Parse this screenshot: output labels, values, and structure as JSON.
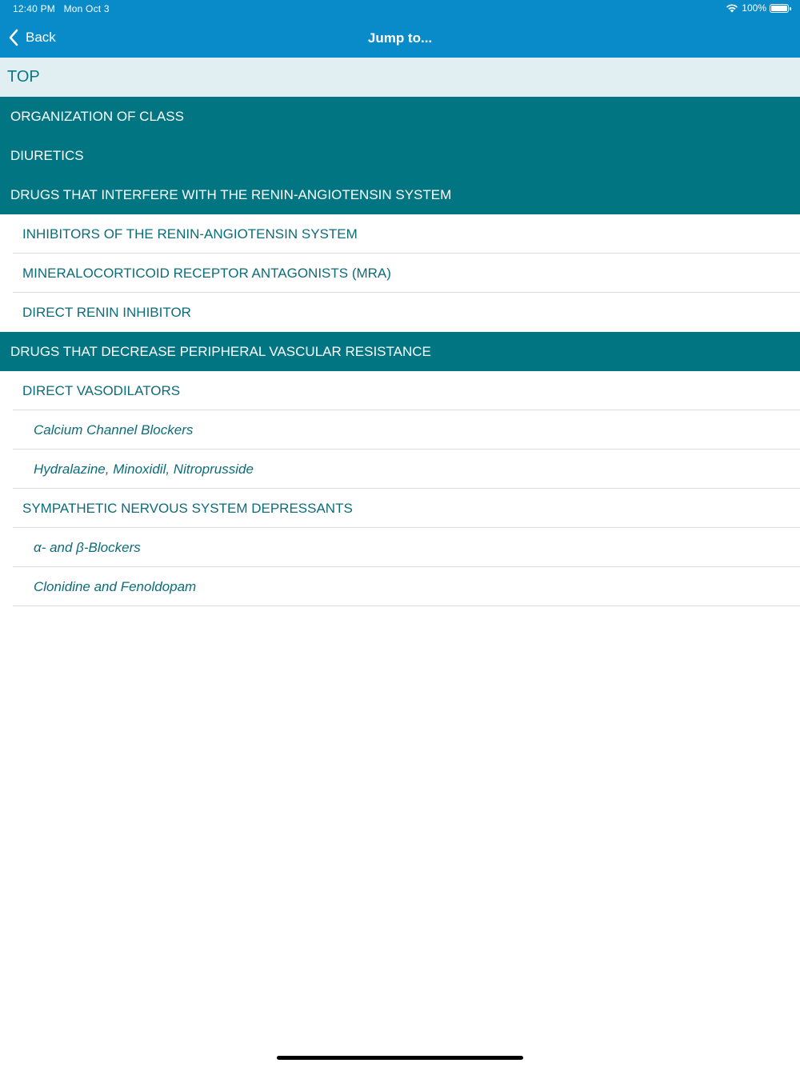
{
  "status_bar": {
    "time": "12:40 PM",
    "date": "Mon Oct 3",
    "battery": "100%"
  },
  "nav": {
    "back_label": "Back",
    "title": "Jump to..."
  },
  "toc": {
    "top": "TOP",
    "items": [
      {
        "label": "ORGANIZATION OF CLASS",
        "level": 1
      },
      {
        "label": "DIURETICS",
        "level": 1
      },
      {
        "label": "DRUGS THAT INTERFERE WITH THE RENIN-ANGIOTENSIN SYSTEM",
        "level": 1
      },
      {
        "label": "INHIBITORS OF THE RENIN-ANGIOTENSIN SYSTEM",
        "level": 2
      },
      {
        "label": "MINERALOCORTICOID RECEPTOR ANTAGONISTS (MRA)",
        "level": 2
      },
      {
        "label": "DIRECT RENIN INHIBITOR",
        "level": 2
      },
      {
        "label": "DRUGS THAT DECREASE PERIPHERAL VASCULAR RESISTANCE",
        "level": 1
      },
      {
        "label": "DIRECT VASODILATORS",
        "level": 2
      },
      {
        "label": "Calcium Channel Blockers",
        "level": 3
      },
      {
        "label": "Hydralazine, Minoxidil, Nitroprusside",
        "level": 3
      },
      {
        "label": "SYMPATHETIC NERVOUS SYSTEM DEPRESSANTS",
        "level": 2
      },
      {
        "label": "α- and β-Blockers",
        "level": 3
      },
      {
        "label": "Clonidine and Fenoldopam",
        "level": 3
      }
    ]
  },
  "colors": {
    "header": "#0a8bc9",
    "section": "#017582",
    "top_row_bg": "#e1eef2",
    "item_text": "#0c6c79"
  }
}
